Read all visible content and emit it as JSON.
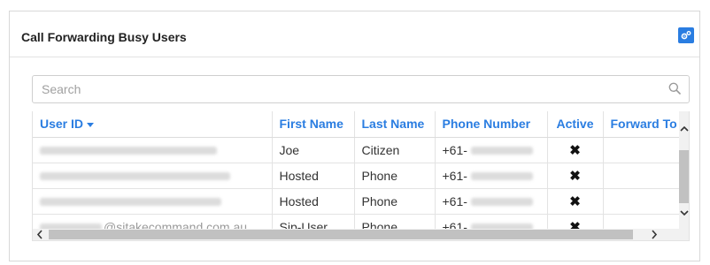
{
  "panel": {
    "title": "Call Forwarding Busy Users",
    "settings_icon": "gears-icon"
  },
  "search": {
    "placeholder": "Search",
    "value": ""
  },
  "table": {
    "columns": [
      {
        "label": "User ID",
        "sorted": "descending"
      },
      {
        "label": "First Name"
      },
      {
        "label": "Last Name"
      },
      {
        "label": "Phone Number"
      },
      {
        "label": "Active"
      },
      {
        "label": "Forward To"
      }
    ],
    "rows": [
      {
        "user_id": "",
        "first_name": "Joe",
        "last_name": "Citizen",
        "phone_prefix": "+61-",
        "active": "✖",
        "forward_to": ""
      },
      {
        "user_id": "",
        "first_name": "Hosted",
        "last_name": "Phone",
        "phone_prefix": "+61-",
        "active": "✖",
        "forward_to": ""
      },
      {
        "user_id": "",
        "first_name": "Hosted",
        "last_name": "Phone",
        "phone_prefix": "+61-",
        "active": "✖",
        "forward_to": ""
      },
      {
        "user_id": "@sitakecommand.com.au",
        "first_name": "Sip-User",
        "last_name": "Phone",
        "phone_prefix": "+61-",
        "active": "✖",
        "forward_to": ""
      }
    ]
  },
  "colors": {
    "accent": "#2a7de1",
    "header_text": "#2a7de1",
    "border": "#d8d8d8"
  }
}
